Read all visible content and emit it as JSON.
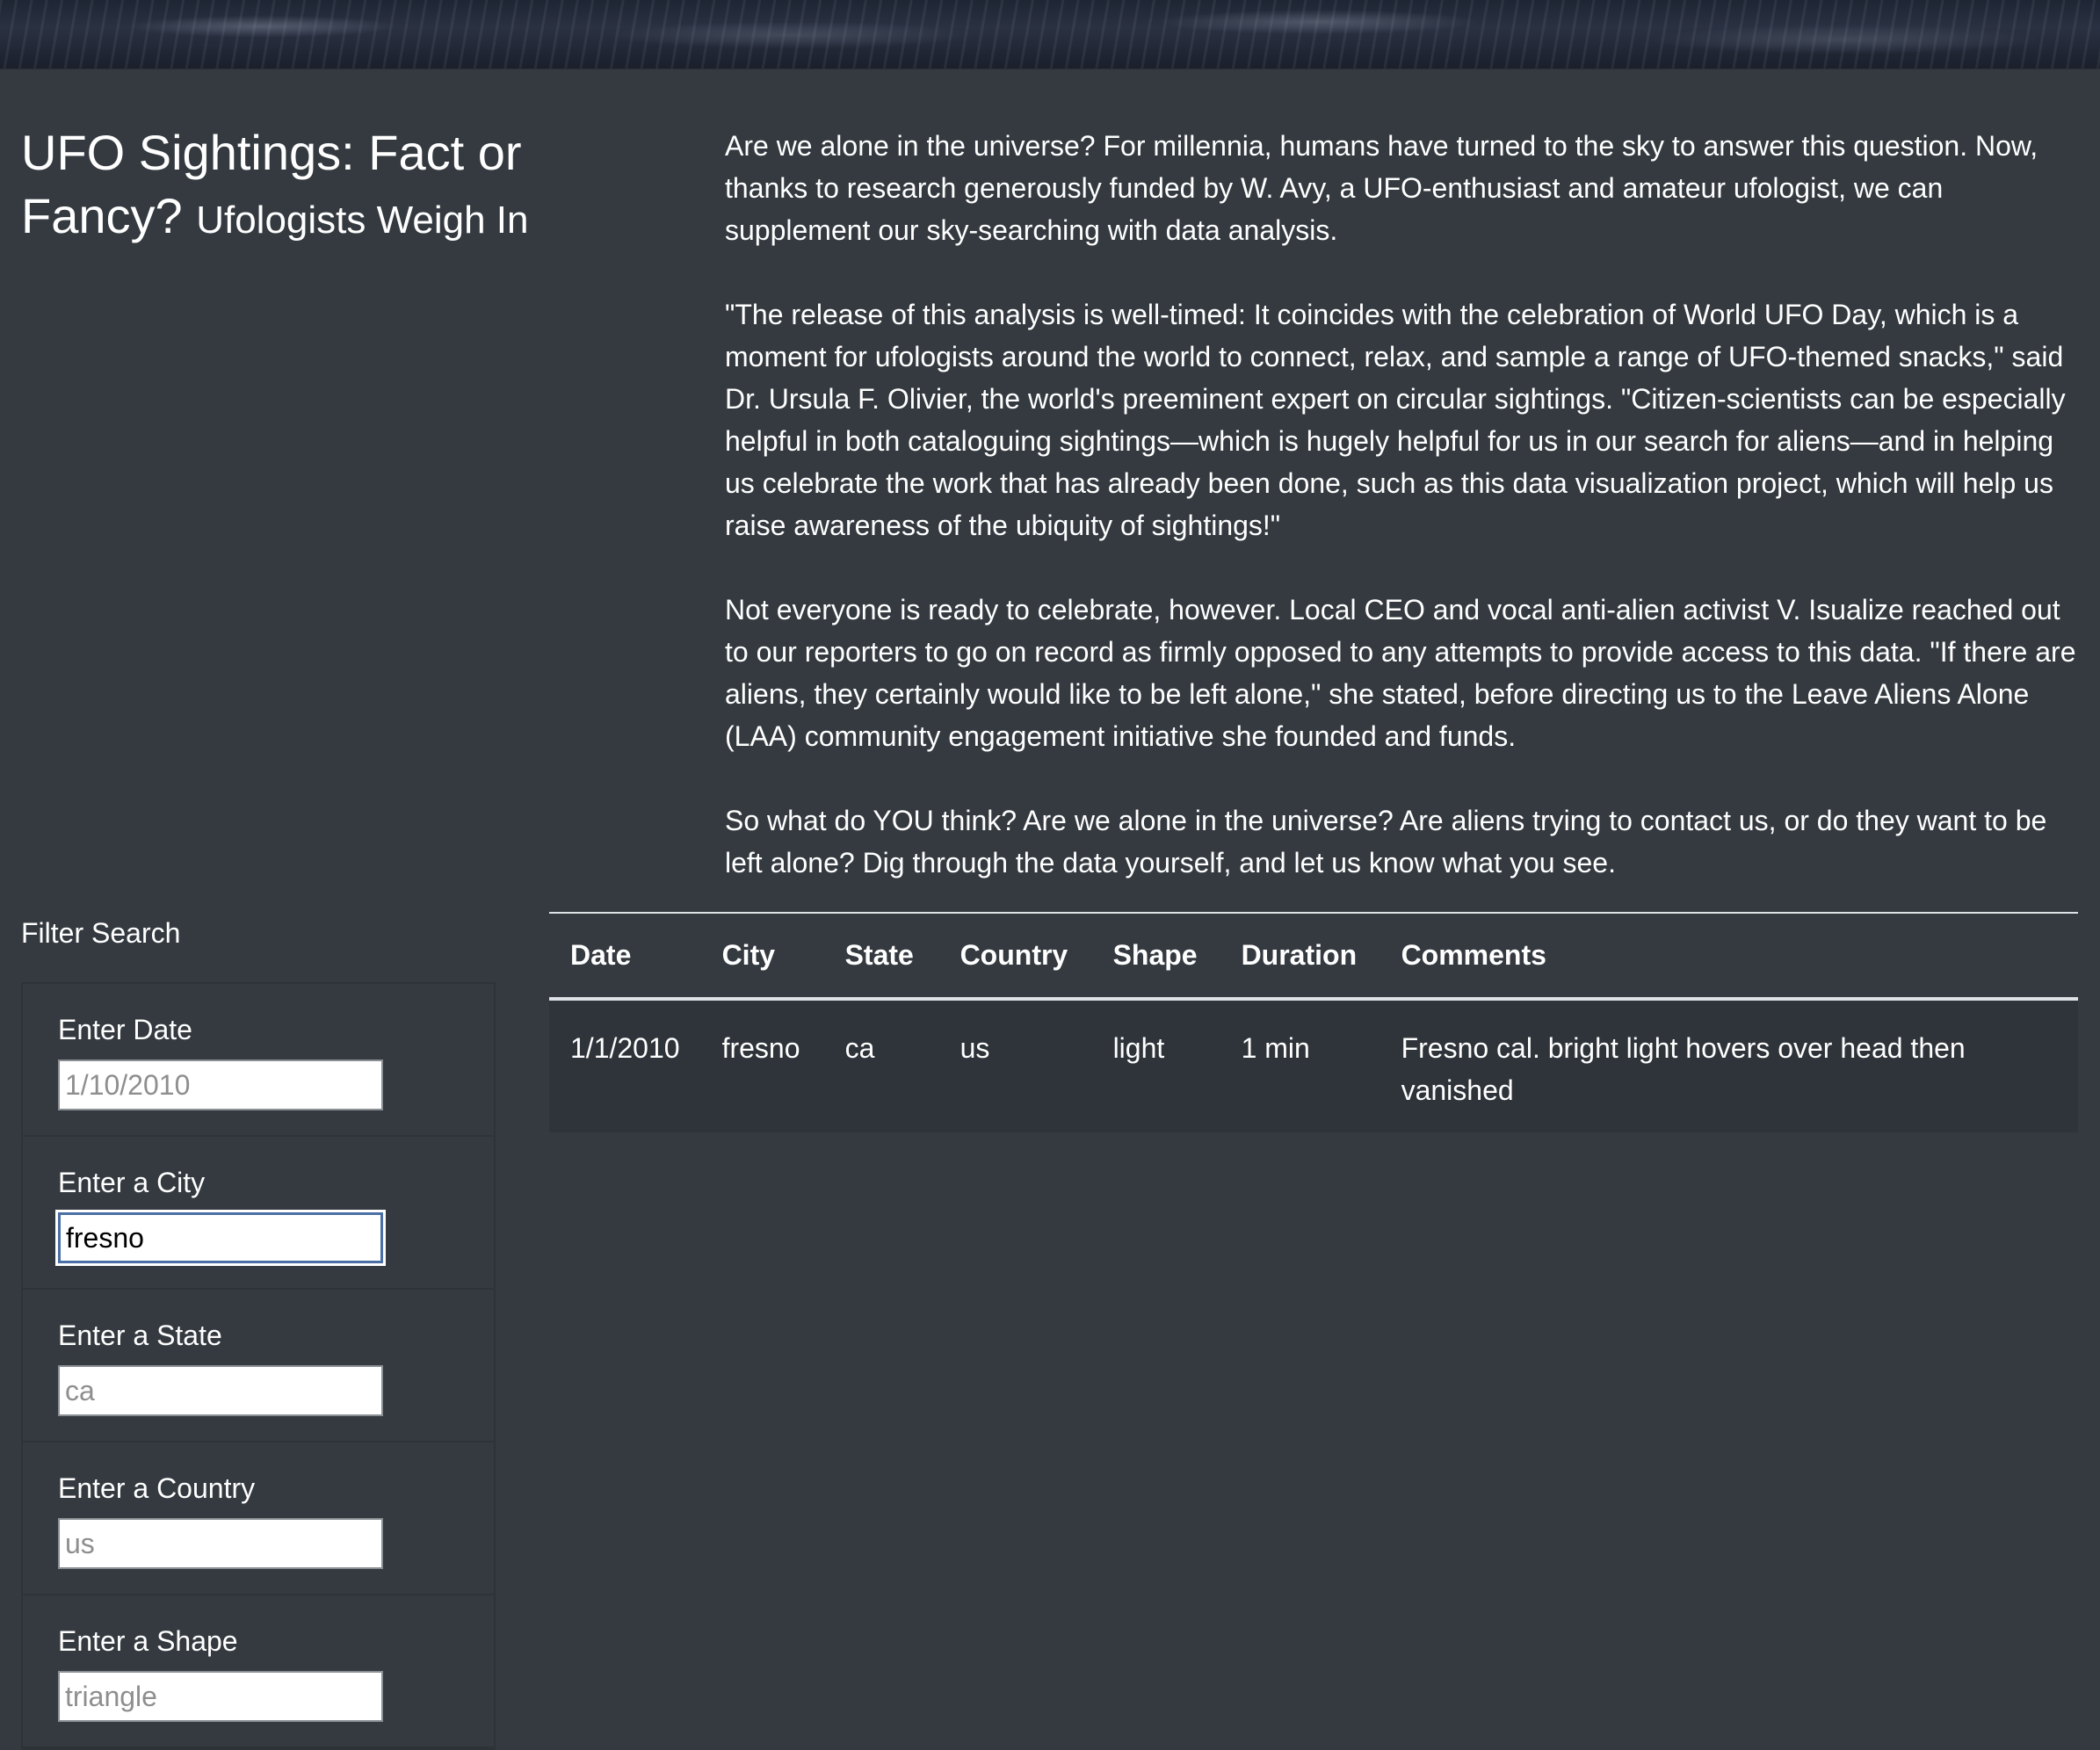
{
  "header": {
    "title": "UFO Sightings: Fact or Fancy?",
    "subtitle": "Ufologists Weigh In"
  },
  "article": {
    "paragraphs": [
      "Are we alone in the universe? For millennia, humans have turned to the sky to answer this question. Now, thanks to research generously funded by W. Avy, a UFO-enthusiast and amateur ufologist, we can supplement our sky-searching with data analysis.",
      "\"The release of this analysis is well-timed: It coincides with the celebration of World UFO Day, which is a moment for ufologists around the world to connect, relax, and sample a range of UFO-themed snacks,\" said Dr. Ursula F. Olivier, the world's preeminent expert on circular sightings. \"Citizen-scientists can be especially helpful in both cataloguing sightings—which is hugely helpful for us in our search for aliens—and in helping us celebrate the work that has already been done, such as this data visualization project, which will help us raise awareness of the ubiquity of sightings!\"",
      "Not everyone is ready to celebrate, however. Local CEO and vocal anti-alien activist V. Isualize reached out to our reporters to go on record as firmly opposed to any attempts to provide access to this data. \"If there are aliens, they certainly would like to be left alone,\" she stated, before directing us to the Leave Aliens Alone (LAA) community engagement initiative she founded and funds.",
      "So what do YOU think? Are we alone in the universe? Are aliens trying to contact us, or do they want to be left alone? Dig through the data yourself, and let us know what you see."
    ]
  },
  "filters": {
    "heading": "Filter Search",
    "date": {
      "label": "Enter Date",
      "value": "",
      "placeholder": "1/10/2010"
    },
    "city": {
      "label": "Enter a City",
      "value": "fresno",
      "placeholder": ""
    },
    "state": {
      "label": "Enter a State",
      "value": "",
      "placeholder": "ca"
    },
    "country": {
      "label": "Enter a Country",
      "value": "",
      "placeholder": "us"
    },
    "shape": {
      "label": "Enter a Shape",
      "value": "",
      "placeholder": "triangle"
    }
  },
  "table": {
    "headers": [
      "Date",
      "City",
      "State",
      "Country",
      "Shape",
      "Duration",
      "Comments"
    ],
    "rows": [
      [
        "1/1/2010",
        "fresno",
        "ca",
        "us",
        "light",
        "1 min",
        "Fresno cal. bright light hovers over head then vanished"
      ]
    ]
  }
}
